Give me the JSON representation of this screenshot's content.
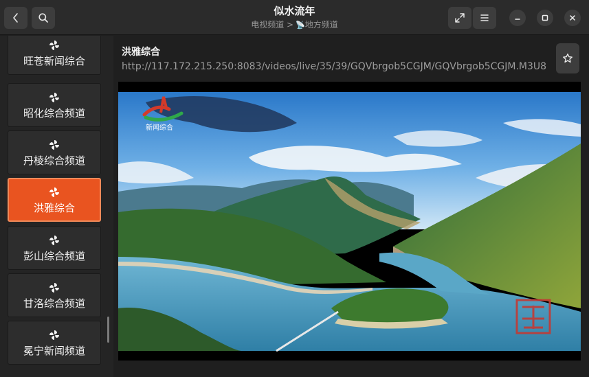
{
  "window": {
    "title": "似水流年",
    "breadcrumb_parent": "电视频道",
    "breadcrumb_sep": ">",
    "breadcrumb_icon": "📡",
    "breadcrumb_current": "地方频道"
  },
  "header_icons": [
    "back-icon",
    "search-icon",
    "fullscreen-icon",
    "hamburger-menu-icon",
    "minimize-icon",
    "maximize-icon",
    "close-icon"
  ],
  "sidebar": {
    "items": [
      {
        "label": "旺苍新闻综合",
        "icon": "channel-pinwheel-icon"
      },
      {
        "label": "昭化综合频道",
        "icon": "channel-pinwheel-icon"
      },
      {
        "label": "丹棱综合频道",
        "icon": "channel-pinwheel-icon"
      },
      {
        "label": "洪雅综合",
        "icon": "channel-pinwheel-icon",
        "active": true
      },
      {
        "label": "彭山综合频道",
        "icon": "channel-pinwheel-icon"
      },
      {
        "label": "甘洛综合频道",
        "icon": "channel-pinwheel-icon"
      },
      {
        "label": "冕宁新闻频道",
        "icon": "channel-pinwheel-icon"
      }
    ]
  },
  "main": {
    "channel_name": "洪雅综合",
    "stream_url": "http://117.172.215.250:8083/videos/live/35/39/GQVbrgob5CGJM/GQVbrgob5CGJM.M3U8",
    "favorite_icon": "star-icon",
    "video_logo_text": "新闻综合"
  },
  "colors": {
    "accent": "#e95420",
    "header_bg": "#2b2b2b",
    "button_bg": "#3d3d3d"
  }
}
